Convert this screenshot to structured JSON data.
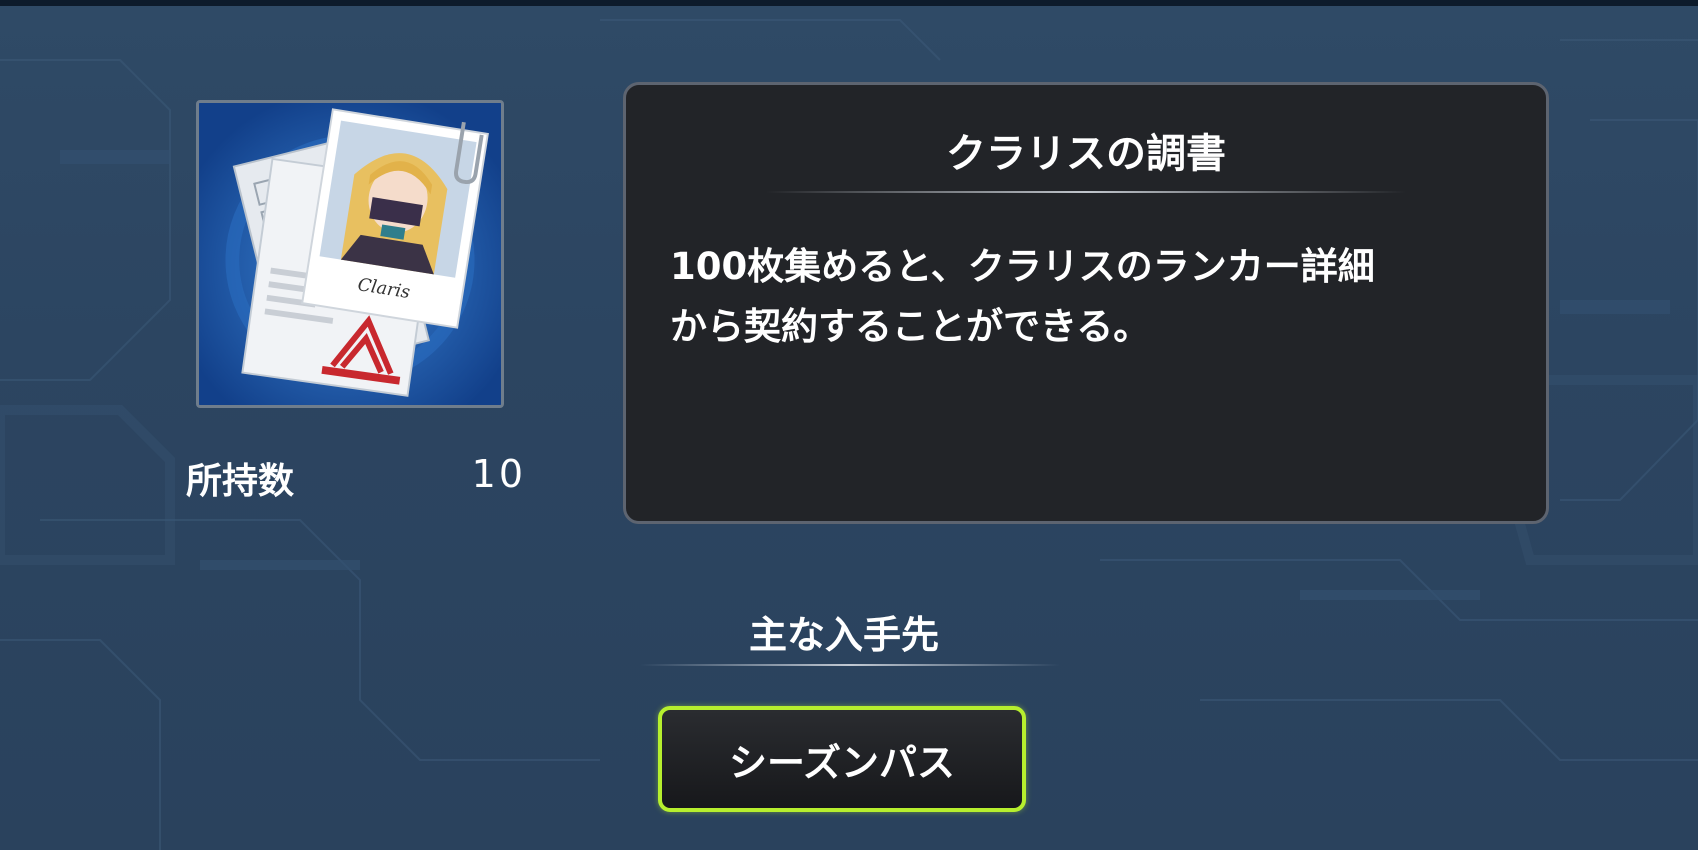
{
  "item": {
    "icon": "claris-dossier-icon",
    "card_caption": "Claris",
    "owned_label": "所持数",
    "owned_count": "10"
  },
  "description": {
    "title": "クラリスの調書",
    "body": "100枚集めると、クラリスのランカー詳細\nから契約することができる。"
  },
  "sources": {
    "heading": "主な入手先",
    "buttons": [
      {
        "label": "シーズンパス"
      }
    ]
  },
  "colors": {
    "panel_bg": "#222428",
    "button_border": "#b6ef2e",
    "background": "#2c4561"
  }
}
